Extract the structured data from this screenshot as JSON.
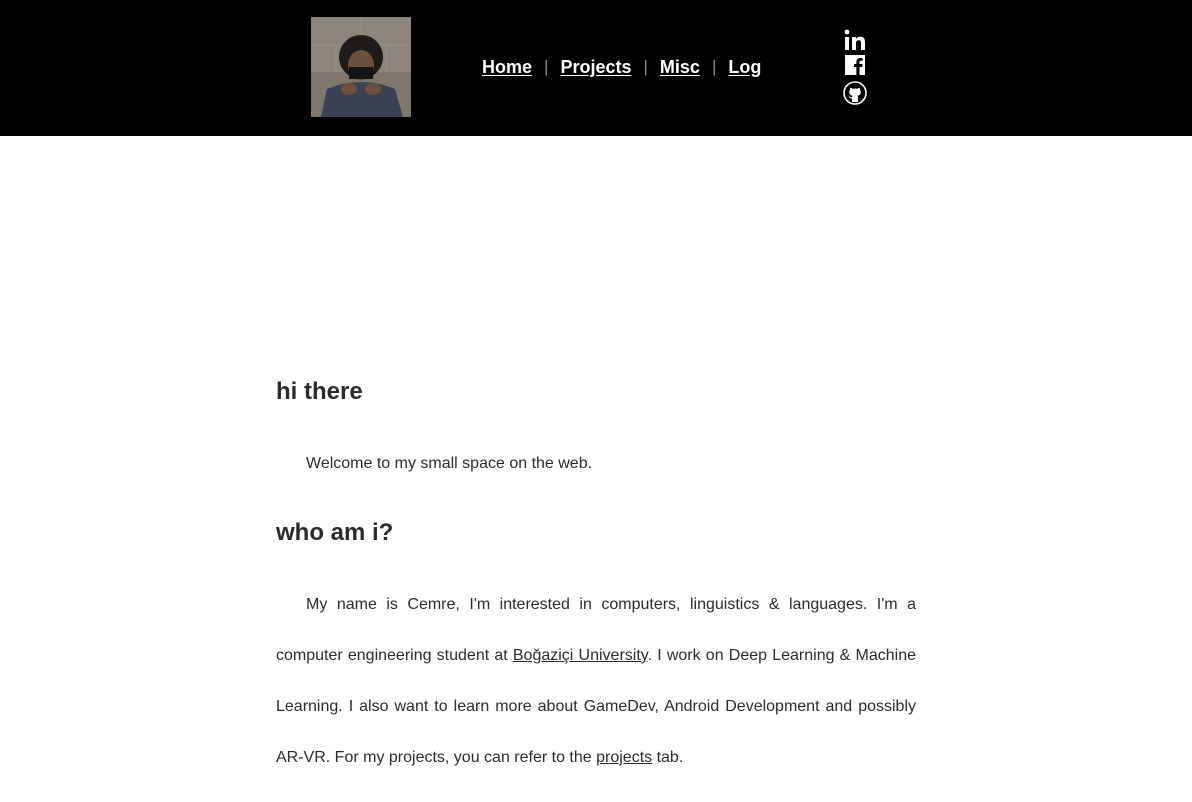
{
  "header": {
    "avatar_alt": "profile photo",
    "nav": [
      {
        "label": "Home"
      },
      {
        "label": "Projects"
      },
      {
        "label": "Misc"
      },
      {
        "label": "Log"
      }
    ],
    "separator": "|",
    "social": [
      {
        "icon": "linkedin-icon"
      },
      {
        "icon": "facebook-icon"
      },
      {
        "icon": "github-icon"
      }
    ],
    "colors": {
      "background": "#000000",
      "link": "#ffffff",
      "separator": "#8a8a8a"
    }
  },
  "main": {
    "intro_heading": "hi there",
    "intro_text": "Welcome to my small space on the web.",
    "about_heading": "who am i?",
    "about": {
      "part1": "My name is Cemre, I'm interested in computers, linguistics & languages. I'm a computer engineering student at ",
      "university_link": "Boğaziçi University",
      "part2": ". I work on Deep Learning & Machine Learning. I also want to learn more about GameDev, Android Development and possibly AR-VR. For my projects, you can refer to the ",
      "projects_link": "projects",
      "part3": " tab."
    },
    "colors": {
      "text": "#2b2b2b",
      "background": "#ffffff"
    }
  }
}
